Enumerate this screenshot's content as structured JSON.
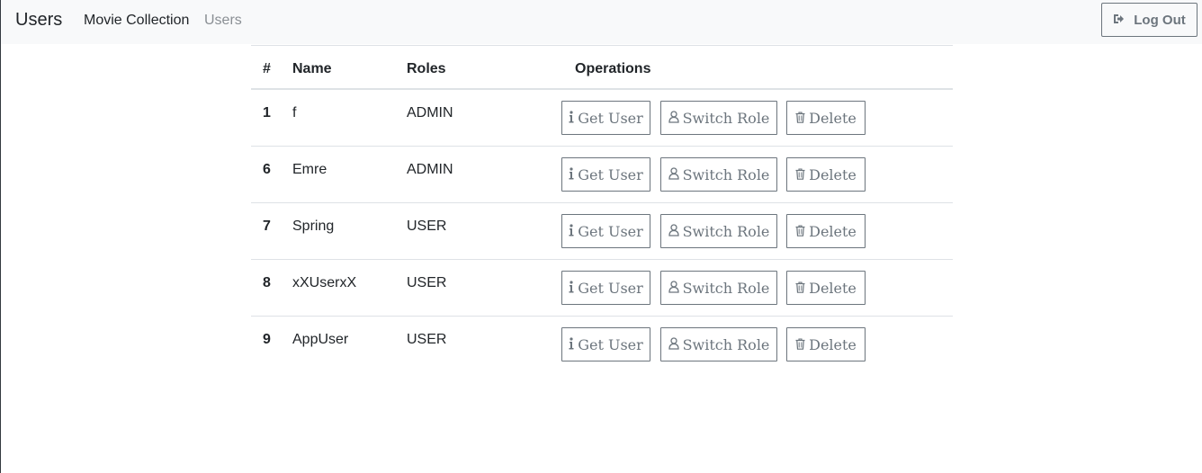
{
  "navbar": {
    "brand": "Users",
    "links": [
      "Movie Collection",
      "Users"
    ],
    "logout_label": "Log Out"
  },
  "table": {
    "headers": [
      "#",
      "Name",
      "Roles",
      "Operations"
    ],
    "rows": [
      {
        "id": "1",
        "name": "f",
        "role": "ADMIN"
      },
      {
        "id": "6",
        "name": "Emre",
        "role": "ADMIN"
      },
      {
        "id": "7",
        "name": "Spring",
        "role": "USER"
      },
      {
        "id": "8",
        "name": "xXUserxX",
        "role": "USER"
      },
      {
        "id": "9",
        "name": "AppUser",
        "role": "USER"
      }
    ],
    "buttons": {
      "get_user": "Get User",
      "switch_role": "Switch Role",
      "delete": "Delete"
    }
  },
  "icons": {
    "logout": "sign-out-icon",
    "get_user": "info-icon",
    "switch_role": "user-icon",
    "delete": "trash-icon"
  },
  "colors": {
    "navbar_bg": "#f8f9fa",
    "button_border": "#6c757d",
    "muted_link": "#8a8f94"
  }
}
